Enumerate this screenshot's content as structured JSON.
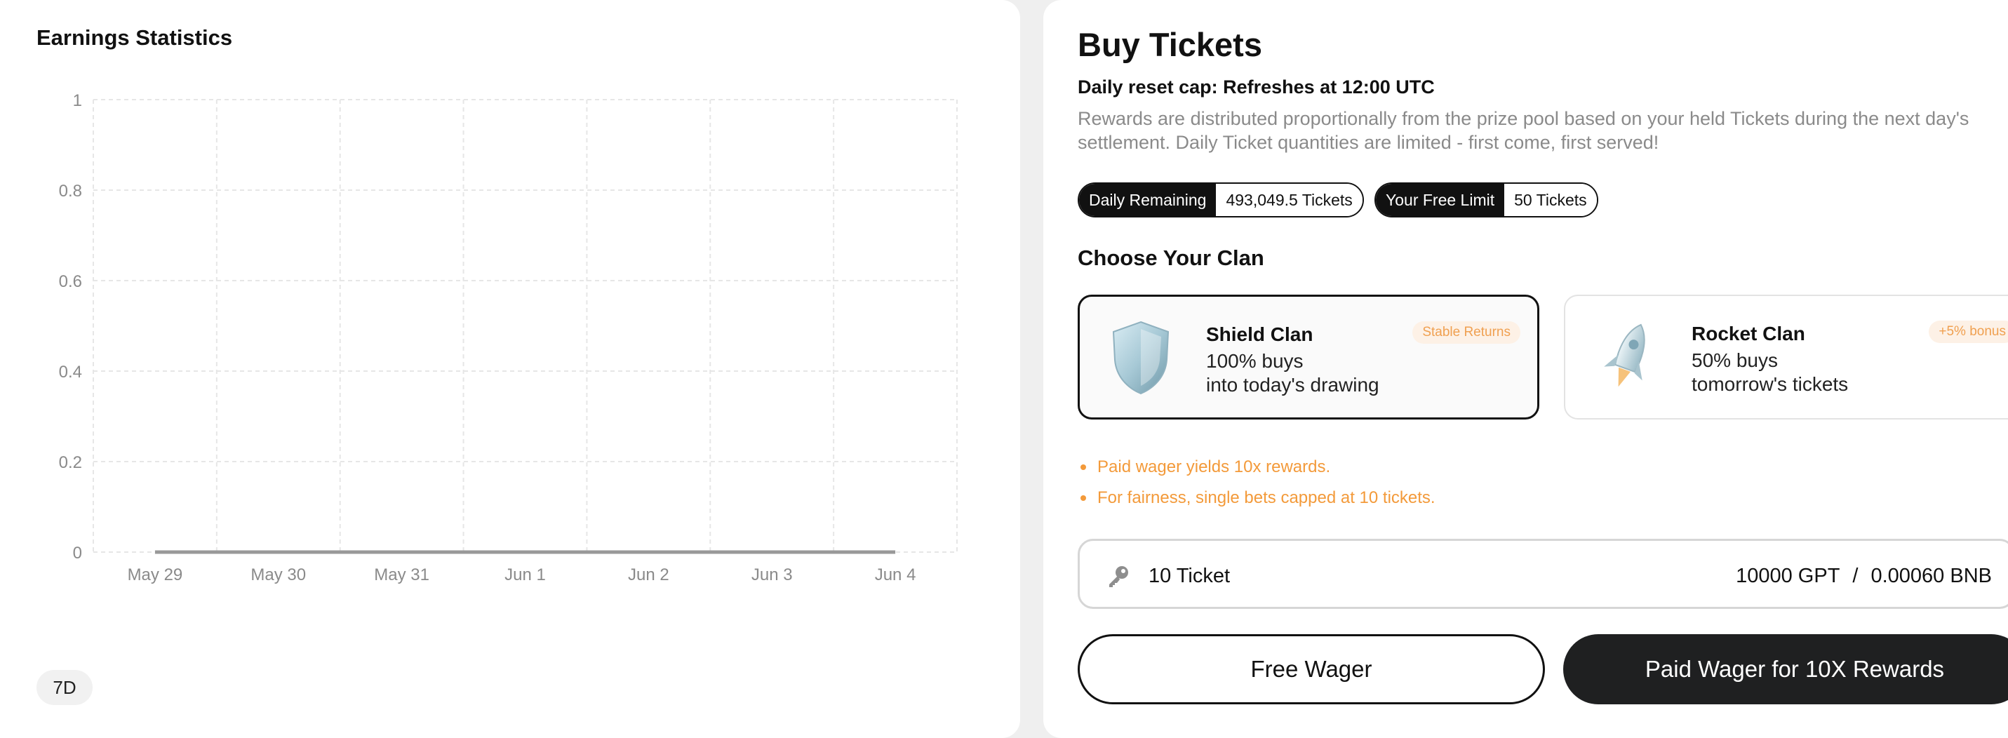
{
  "earnings": {
    "title": "Earnings Statistics",
    "range_label": "7D"
  },
  "chart_data": {
    "type": "line",
    "title": "Earnings Statistics",
    "x": [
      "May 29",
      "May 30",
      "May 31",
      "Jun 1",
      "Jun 2",
      "Jun 3",
      "Jun 4"
    ],
    "series": [
      {
        "values": [
          0,
          0,
          0,
          0,
          0,
          0,
          0
        ],
        "color": "#999999"
      }
    ],
    "y_ticks": [
      "0",
      "0.2",
      "0.4",
      "0.6",
      "0.8",
      "1"
    ],
    "ylim": [
      0,
      1
    ],
    "grid": true,
    "xlabel": "",
    "ylabel": ""
  },
  "buy": {
    "title": "Buy Tickets",
    "subtitle": "Daily reset cap: Refreshes at 12:00 UTC",
    "description": "Rewards are distributed proportionally from the prize pool based on your held Tickets during the next day's settlement. Daily Ticket quantities are limited - first come, first served!",
    "daily_remaining_label": "Daily Remaining",
    "daily_remaining_value": "493,049.5 Tickets",
    "free_limit_label": "Your Free Limit",
    "free_limit_value": "50 Tickets",
    "clan_heading": "Choose Your Clan",
    "clans": [
      {
        "name": "Shield Clan",
        "tag": "Stable Returns",
        "line1": "100% buys",
        "line2": "into today's drawing",
        "icon": "shield-icon",
        "selected": true
      },
      {
        "name": "Rocket Clan",
        "tag": "+5% bonus",
        "line1": "50% buys",
        "line2": "tomorrow's tickets",
        "icon": "rocket-icon",
        "selected": false
      }
    ],
    "notes": [
      "Paid wager yields 10x rewards.",
      "For fairness, single bets capped at 10 tickets."
    ],
    "ticket_count": "10 Ticket",
    "gpt_price": "10000 GPT",
    "separator": "/",
    "bnb_price": "0.00060 BNB",
    "free_button": "Free Wager",
    "paid_button": "Paid Wager for 10X Rewards"
  },
  "colors": {
    "accent_orange": "#f39a3a",
    "dark": "#1f2021",
    "grid": "#e6e6e6"
  }
}
